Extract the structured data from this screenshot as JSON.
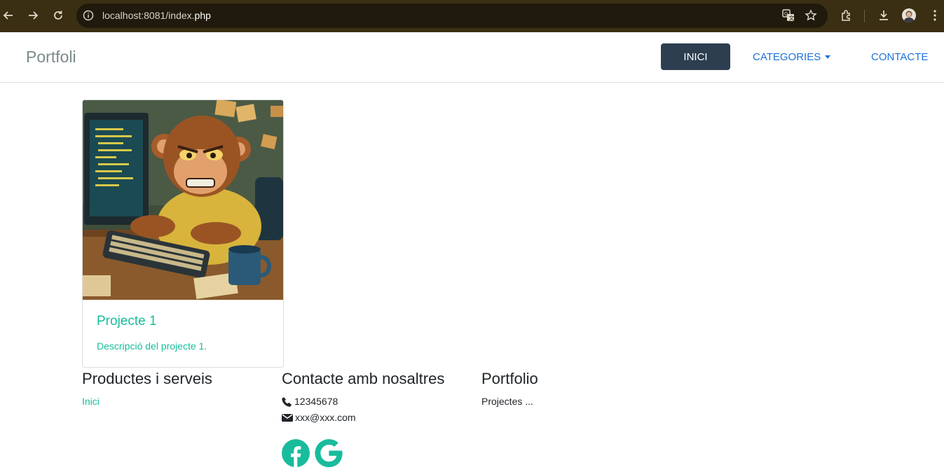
{
  "browser": {
    "url_host": "localhost:8081/index.",
    "url_file": "php",
    "icons": [
      "back-arrow-icon",
      "forward-arrow-icon",
      "reload-icon",
      "site-info-icon",
      "translate-icon",
      "bookmark-star-icon",
      "extensions-icon",
      "download-icon",
      "profile-avatar-icon",
      "menu-kebab-icon"
    ]
  },
  "navbar": {
    "brand": "Portfoli",
    "items": [
      {
        "label": "INICI",
        "active": true
      },
      {
        "label": "CATEGORIES",
        "dropdown": true
      },
      {
        "label": "CONTACTE"
      }
    ]
  },
  "card": {
    "image_alt": "monkey-programmer-illustration",
    "title": "Projecte 1",
    "description": "Descripció del projecte 1."
  },
  "footer": {
    "products": {
      "title": "Productes i serveis",
      "link": "Inici"
    },
    "contact": {
      "title": "Contacte amb nosaltres",
      "phone": "12345678",
      "email": "xxx@xxx.com",
      "social": [
        "facebook-icon",
        "google-icon"
      ]
    },
    "portfolio": {
      "title": "Portfolio",
      "text": "Projectes ..."
    }
  },
  "colors": {
    "chrome": "#3a2f12",
    "primary_dark": "#2c3e50",
    "link_blue": "#1a73d9",
    "accent_teal": "#18bc9c",
    "muted_brand": "#7b8a8b"
  }
}
